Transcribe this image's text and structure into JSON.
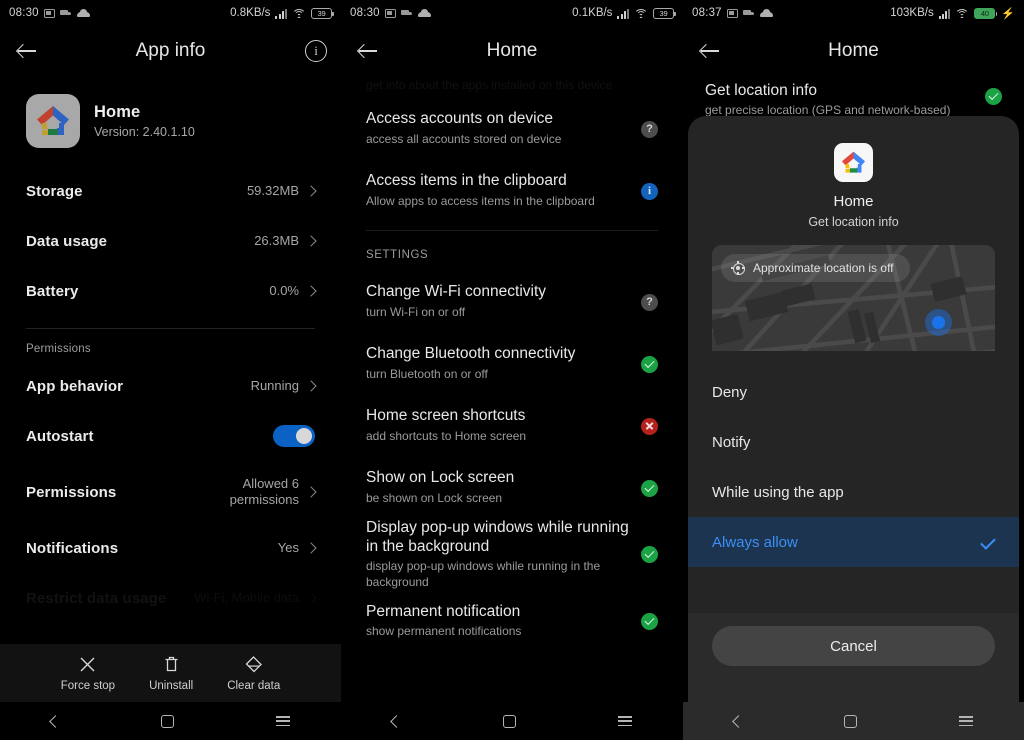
{
  "panel1": {
    "status": {
      "time": "08:30",
      "speed": "0.8KB/s",
      "battery": "39",
      "icons": [
        "cast-icon",
        "truck-icon",
        "cloud-icon",
        "signal-icon",
        "wifi-icon",
        "battery-icon"
      ]
    },
    "appbar": {
      "title": "App info",
      "back": "back-arrow-icon",
      "info": "i"
    },
    "app": {
      "name": "Home",
      "version": "Version: 2.40.1.10",
      "icon": "google-home-icon"
    },
    "rows": [
      {
        "label": "Storage",
        "value": "59.32MB",
        "type": "chevron"
      },
      {
        "label": "Data usage",
        "value": "26.3MB",
        "type": "chevron"
      },
      {
        "label": "Battery",
        "value": "0.0%",
        "type": "chevron"
      }
    ],
    "permissions_caption": "Permissions",
    "perm_rows": [
      {
        "label": "App behavior",
        "value": "Running",
        "type": "chevron"
      },
      {
        "label": "Autostart",
        "value": "",
        "type": "toggle",
        "on": true
      },
      {
        "label": "Permissions",
        "value": "Allowed 6 permissions",
        "type": "chevron"
      },
      {
        "label": "Notifications",
        "value": "Yes",
        "type": "chevron"
      },
      {
        "label": "Restrict data usage",
        "value": "Wi-Fi, Mobile data",
        "type": "chevron"
      }
    ],
    "actions": [
      {
        "label": "Force stop",
        "icon": "close-x-icon"
      },
      {
        "label": "Uninstall",
        "icon": "trash-icon"
      },
      {
        "label": "Clear data",
        "icon": "eraser-icon"
      }
    ]
  },
  "panel2": {
    "status": {
      "time": "08:30",
      "speed": "0.1KB/s",
      "battery": "39"
    },
    "appbar": {
      "title": "Home"
    },
    "cut_off_text": "get info about the apps installed on this device",
    "items": [
      {
        "title": "Access accounts on device",
        "sub": "access all accounts stored on device",
        "badge": "question"
      },
      {
        "title": "Access items in the clipboard",
        "sub": "Allow apps to access items in the clipboard",
        "badge": "info"
      }
    ],
    "settings_caption": "SETTINGS",
    "settings": [
      {
        "title": "Change Wi-Fi connectivity",
        "sub": "turn Wi-Fi on or off",
        "badge": "question"
      },
      {
        "title": "Change Bluetooth connectivity",
        "sub": "turn Bluetooth on or off",
        "badge": "allowed"
      },
      {
        "title": "Home screen shortcuts",
        "sub": "add shortcuts to Home screen",
        "badge": "denied"
      },
      {
        "title": "Show on Lock screen",
        "sub": "be shown on Lock screen",
        "badge": "allowed"
      },
      {
        "title": "Display pop-up windows while running in the background",
        "sub": "display pop-up windows while running in the background",
        "badge": "allowed"
      },
      {
        "title": "Permanent notification",
        "sub": "show permanent notifications",
        "badge": "allowed"
      }
    ]
  },
  "panel3": {
    "status": {
      "time": "08:37",
      "speed": "103KB/s",
      "battery": "40",
      "charging": true
    },
    "appbar": {
      "title": "Home"
    },
    "header": {
      "title": "Get location info",
      "sub": "get precise location (GPS and network-based)",
      "badge": "allowed"
    },
    "dialog": {
      "app_name": "Home",
      "permission": "Get location info",
      "map_chip": "Approximate location is off",
      "options": [
        {
          "label": "Deny",
          "selected": false
        },
        {
          "label": "Notify",
          "selected": false
        },
        {
          "label": "While using the app",
          "selected": false
        },
        {
          "label": "Always allow",
          "selected": true
        }
      ],
      "cancel": "Cancel"
    }
  },
  "colors": {
    "accent_blue": "#1a73e8",
    "selected_blue": "#3b8ff5",
    "selected_row_bg": "#1c3450",
    "allowed_green": "#1aa245",
    "denied_red": "#b5211d",
    "toggle_on": "#0b62c4",
    "charging_green": "#3ea55a"
  },
  "navbar": {
    "back": "nav-back-icon",
    "home": "nav-home-icon",
    "recents": "nav-recents-icon"
  }
}
